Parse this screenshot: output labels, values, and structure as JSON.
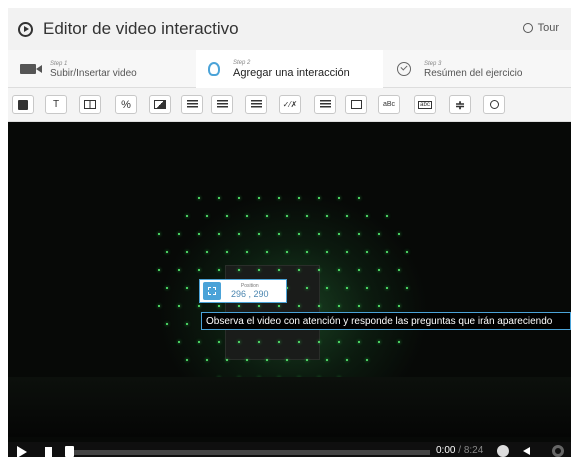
{
  "header": {
    "title": "Editor de video interactivo",
    "tour_label": "Tour"
  },
  "steps": [
    {
      "small": "Step 1",
      "label": "Subir/Insertar video"
    },
    {
      "small": "Step 2",
      "label": "Agregar una interacción"
    },
    {
      "small": "Step 3",
      "label": "Resúmen del ejercicio"
    }
  ],
  "toolbar": {
    "tools": [
      {
        "name": "label-tool",
        "glyph": ""
      },
      {
        "name": "text-tool",
        "glyph": "T"
      },
      {
        "name": "table-tool",
        "glyph": ""
      },
      {
        "name": "link-tool",
        "glyph": ""
      },
      {
        "name": "image-tool",
        "glyph": ""
      },
      {
        "name": "statements-tool",
        "glyph": ""
      },
      {
        "name": "single-choice-tool",
        "glyph": ""
      },
      {
        "name": "multiple-choice-tool",
        "glyph": ""
      },
      {
        "name": "true-false-tool",
        "glyph": ""
      },
      {
        "name": "fill-blanks-tool",
        "glyph": ""
      },
      {
        "name": "drag-text-tool",
        "glyph": ""
      },
      {
        "name": "mark-words-tool",
        "glyph": ""
      },
      {
        "name": "drag-drop-tool",
        "glyph": ""
      },
      {
        "name": "crossroads-tool",
        "glyph": ""
      },
      {
        "name": "navigation-hotspot-tool",
        "glyph": ""
      }
    ]
  },
  "interaction": {
    "position_label": "Position",
    "position_value": "296 , 290",
    "tooltip": "Observa el video con atención y responde las preguntas que irán apareciendo"
  },
  "player": {
    "current_time": "0:00",
    "separator": "/",
    "total_time": "8:24",
    "progress": 0.0
  },
  "colors": {
    "accent": "#4ba3d8",
    "video_bg": "#070907",
    "laser": "#5cff7a"
  }
}
